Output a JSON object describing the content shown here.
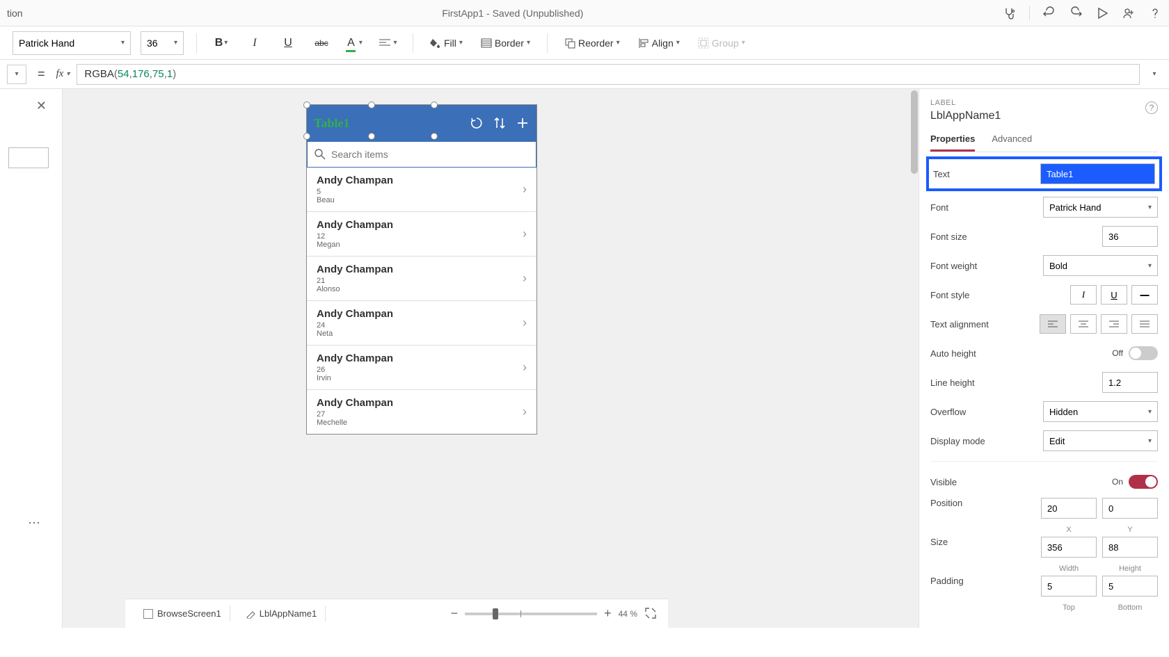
{
  "titlebar": {
    "left_fragment": "tion",
    "title": "FirstApp1 - Saved (Unpublished)"
  },
  "ribbon": {
    "font": "Patrick Hand",
    "size": "36",
    "fill": "Fill",
    "border": "Border",
    "reorder": "Reorder",
    "align": "Align",
    "group": "Group"
  },
  "formula": {
    "fn": "RGBA",
    "args": [
      "54",
      "176",
      "75",
      "1"
    ]
  },
  "phone": {
    "app_title": "Table1",
    "search_placeholder": "Search items",
    "items": [
      {
        "name": "Andy Champan",
        "sub1": "5",
        "sub2": "Beau"
      },
      {
        "name": "Andy Champan",
        "sub1": "12",
        "sub2": "Megan"
      },
      {
        "name": "Andy Champan",
        "sub1": "21",
        "sub2": "Alonso"
      },
      {
        "name": "Andy Champan",
        "sub1": "24",
        "sub2": "Neta"
      },
      {
        "name": "Andy Champan",
        "sub1": "26",
        "sub2": "Irvin"
      },
      {
        "name": "Andy Champan",
        "sub1": "27",
        "sub2": "Mechelle"
      }
    ]
  },
  "props": {
    "heading": "LABEL",
    "name": "LblAppName1",
    "tab_properties": "Properties",
    "tab_advanced": "Advanced",
    "text_label": "Text",
    "text_value": "Table1",
    "font_label": "Font",
    "font_value": "Patrick Hand",
    "fontsize_label": "Font size",
    "fontsize_value": "36",
    "fontweight_label": "Font weight",
    "fontweight_value": "Bold",
    "fontstyle_label": "Font style",
    "align_label": "Text alignment",
    "autoheight_label": "Auto height",
    "autoheight_value": "Off",
    "lineheight_label": "Line height",
    "lineheight_value": "1.2",
    "overflow_label": "Overflow",
    "overflow_value": "Hidden",
    "displaymode_label": "Display mode",
    "displaymode_value": "Edit",
    "visible_label": "Visible",
    "visible_value": "On",
    "position_label": "Position",
    "position_x": "20",
    "position_y": "0",
    "pos_x_lbl": "X",
    "pos_y_lbl": "Y",
    "size_label": "Size",
    "size_w": "356",
    "size_h": "88",
    "size_w_lbl": "Width",
    "size_h_lbl": "Height",
    "padding_label": "Padding",
    "padding_t": "5",
    "padding_b": "5",
    "padding_t_lbl": "Top",
    "padding_b_lbl": "Bottom"
  },
  "bottombar": {
    "crumb1": "BrowseScreen1",
    "crumb2": "LblAppName1",
    "zoom_pct": "44",
    "zoom_unit": "%"
  }
}
